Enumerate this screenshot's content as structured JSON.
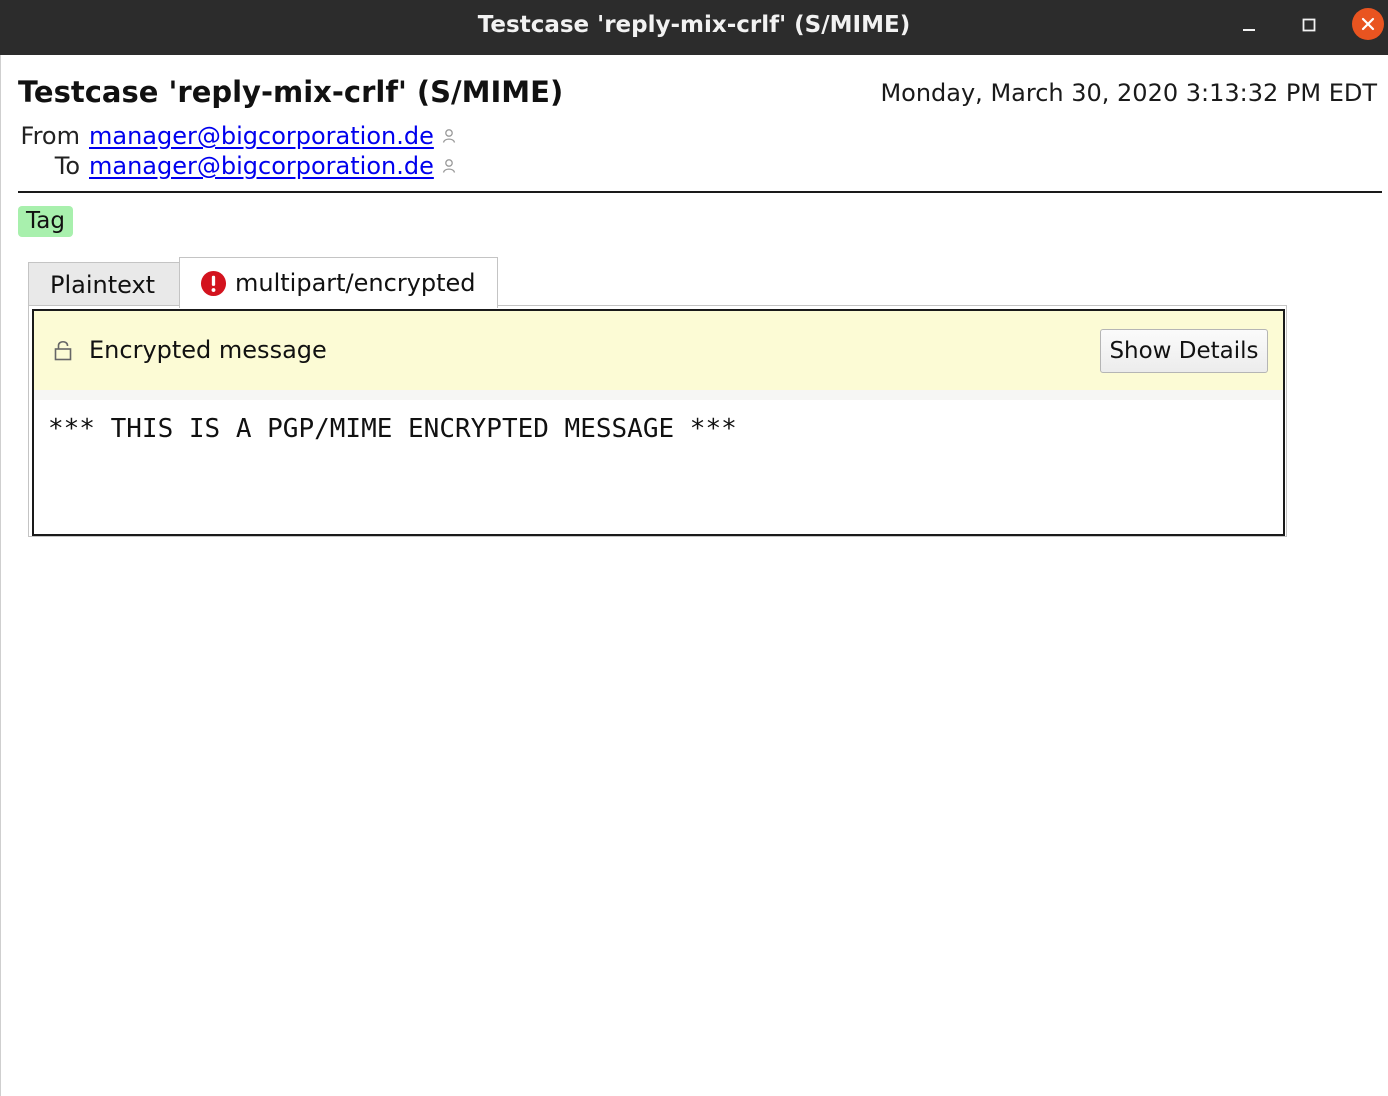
{
  "window": {
    "title": "Testcase 'reply-mix-crlf' (S/MIME)",
    "controls": [
      "minimize-icon",
      "maximize-icon",
      "close-icon"
    ],
    "close_color": "#e95420"
  },
  "header": {
    "subject": "Testcase 'reply-mix-crlf' (S/MIME)",
    "date": "Monday, March 30, 2020 3:13:32 PM EDT",
    "from_label": "From",
    "from_address": "manager@bigcorporation.de",
    "to_label": "To",
    "to_address": "manager@bigcorporation.de",
    "tag": "Tag",
    "tag_color": "#a8f0ad",
    "link_color": "#0000ee"
  },
  "tabs": [
    {
      "label": "Plaintext",
      "active": false
    },
    {
      "label": "multipart/encrypted",
      "active": true,
      "icon": "error-icon",
      "icon_color": "#d3131e"
    }
  ],
  "message": {
    "notice_text": "Encrypted message",
    "notice_icon": "lock-icon",
    "notice_color": "#fcfbd5",
    "details_button": "Show Details",
    "body": "*** THIS IS A PGP/MIME ENCRYPTED MESSAGE ***"
  }
}
